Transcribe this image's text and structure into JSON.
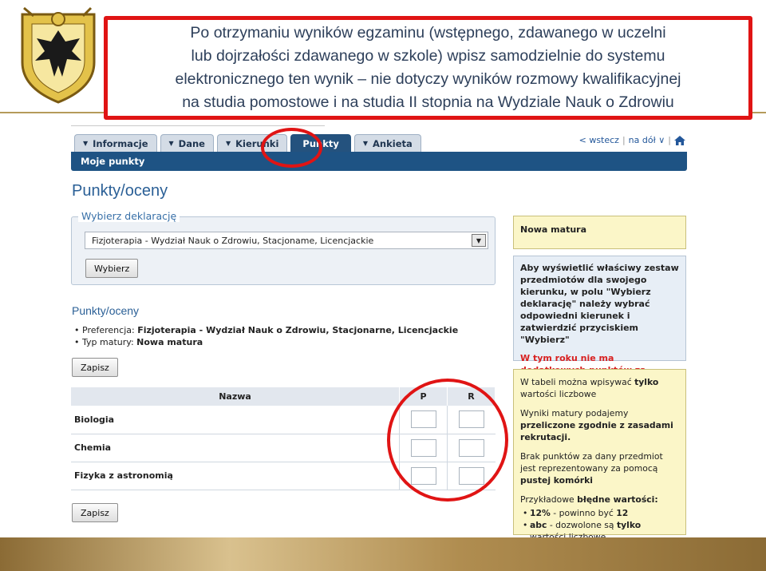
{
  "slide": {
    "header_text": "Po otrzymaniu wyników egzaminu (wstępnego, zdawanego w uczelni\nlub dojrzałości zdawanego w szkole) wpisz samodzielnie do systemu\nelektronicznego ten wynik – nie dotyczy wyników rozmowy kwalifikacyjnej\nna studia pomostowe i na studia II stopnia na Wydziale Nauk o Zdrowiu",
    "annotation_color": "#e01414",
    "footer_color": "#b08d50"
  },
  "nav": {
    "tabs": [
      {
        "label": "Informacje",
        "active": false
      },
      {
        "label": "Dane",
        "active": false
      },
      {
        "label": "Kierunki",
        "active": false
      },
      {
        "label": "Punkty",
        "active": true
      },
      {
        "label": "Ankieta",
        "active": false
      }
    ],
    "links": {
      "back": "< wstecz",
      "sep": "|",
      "down": "na dół ∨",
      "sep2": "|"
    }
  },
  "subnav": {
    "label": "Moje punkty"
  },
  "page": {
    "title": "Punkty/oceny",
    "declaration": {
      "legend": "Wybierz deklarację",
      "selected": "Fizjoterapia - Wydział Nauk o Zdrowiu, Stacjoname, Licencjackie",
      "button": "Wybierz"
    },
    "section_title": "Punkty/oceny",
    "info": {
      "pref_label": "Preferencja: ",
      "pref_value": "Fizjoterapia - Wydział Nauk o Zdrowiu, Stacjonarne, Licencjackie",
      "type_label": "Typ matury: ",
      "type_value": "Nowa matura"
    },
    "save_top": "Zapisz",
    "save_bottom": "Zapisz",
    "table": {
      "headers": {
        "name": "Nazwa",
        "p": "P",
        "r": "R"
      },
      "rows": [
        {
          "name": "Biologia",
          "p": "",
          "r": ""
        },
        {
          "name": "Chemia",
          "p": "",
          "r": ""
        },
        {
          "name": "Fizyka z astronomią",
          "p": "",
          "r": ""
        }
      ]
    }
  },
  "sidebar": {
    "box1": "Nowa matura",
    "box2_text": "Aby wyświetlić właściwy zestaw przedmiotów dla swojego kierunku, w polu \"Wybierz deklarację\" należy wybrać odpowiedni kierunek i zatwierdzić przyciskiem \"Wybierz\"",
    "box2_red": "W tym roku nie ma dodatkowych punktów za maturę rozszerzoną!",
    "box3": {
      "p1_a": "W tabeli można wpisywać ",
      "p1_b": "tylko",
      "p1_c": " wartości liczbowe",
      "p2_a": "Wyniki matury podajemy ",
      "p2_b": "przeliczone zgodnie z zasadami rekrutacji.",
      "p3_a": "Brak punktów za dany przedmiot jest reprezentowany za pomocą ",
      "p3_b": "pustej komórki",
      "p4_a": "Przykładowe ",
      "p4_b": "błędne wartości:",
      "ex1_a": "12%",
      "ex1_b": " - powinno być ",
      "ex1_c": "12",
      "ex2_a": "abc",
      "ex2_b": " - dozwolone są ",
      "ex2_c": "tylko",
      "ex2_d": " wartości liczbowe"
    }
  }
}
